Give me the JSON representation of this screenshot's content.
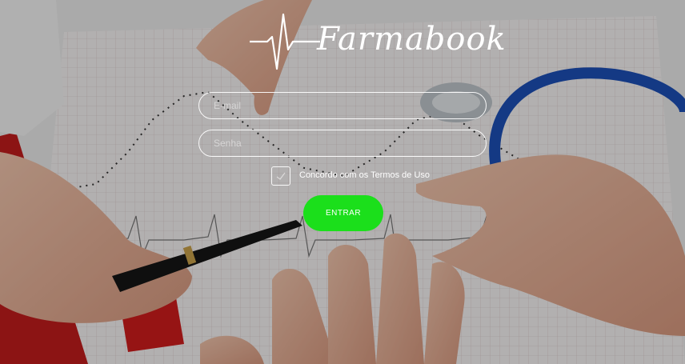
{
  "brand": {
    "name": "Farmabook",
    "logo_icon": "heartbeat-icon"
  },
  "form": {
    "email_placeholder": "E-mail",
    "password_placeholder": "Senha",
    "terms_checked": true,
    "terms_label": "Concordo com os Termos de Uso",
    "submit_label": "ENTRAR"
  },
  "colors": {
    "accent": "#1bdf1b",
    "text": "#ffffff",
    "overlay": "#000000"
  }
}
